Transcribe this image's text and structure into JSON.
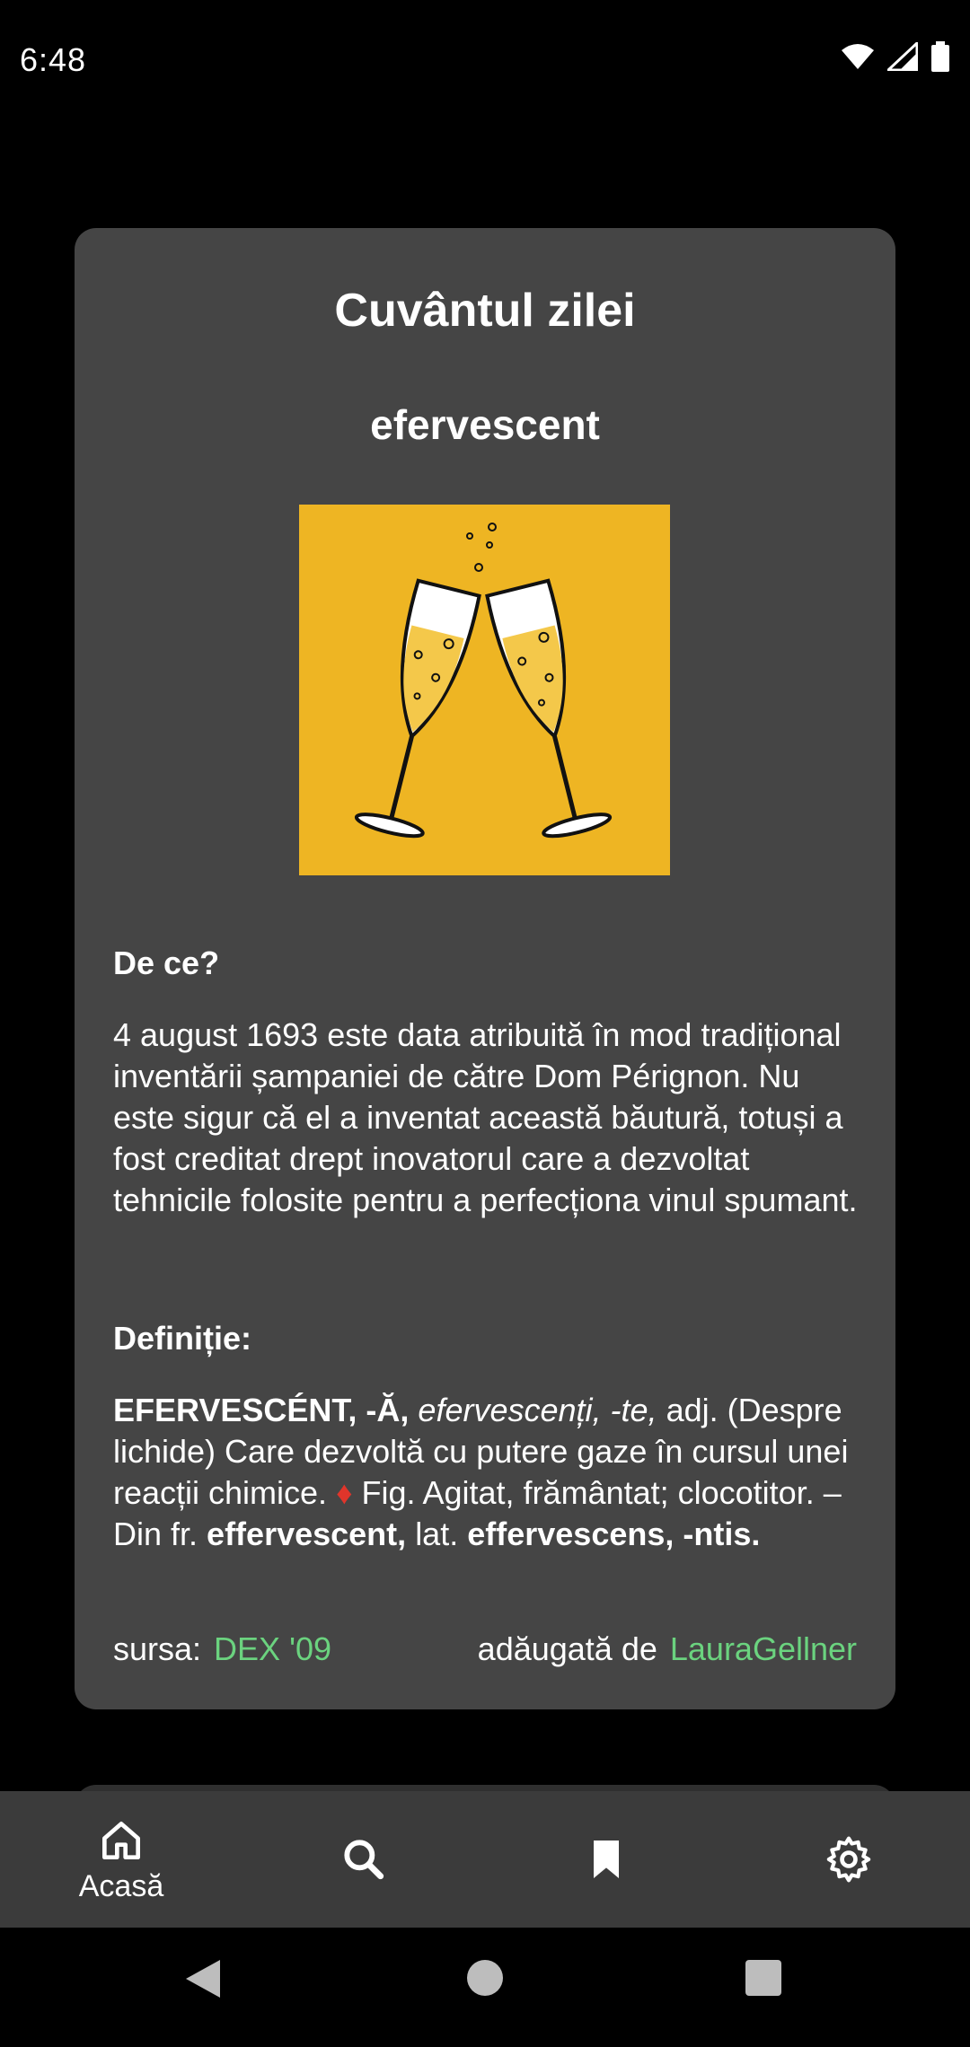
{
  "status_bar": {
    "time": "6:48"
  },
  "card": {
    "title": "Cuvântul zilei",
    "word": "efervescent",
    "why_label": "De ce?",
    "why_text": "4 august 1693 este data atribuită în mod tradițional inventării șampaniei de către Dom Pérignon. Nu este sigur că el a inventat această băutură, totuși a fost creditat drept inovatorul care a dezvoltat tehnicile folosite pentru a perfecționa vinul spumant.",
    "definition_label": "Definiție:",
    "definition": {
      "headword": "EFERVESCÉNT, -Ă,",
      "forms": "efervescenți, -te,",
      "pos": "adj.",
      "text1": "(Despre lichide) Care dezvoltă cu putere gaze în cursul unei reacții chimice.",
      "diamond": "♦",
      "text2": "Fig. Agitat, frământat; clocotitor. – Din fr.",
      "etym1": "effervescent,",
      "lat": "lat.",
      "etym2": "effervescens, -ntis."
    },
    "source_label": "sursa:",
    "source_value": "DEX '09",
    "added_label": "adăugată de",
    "added_value": "LauraGellner"
  },
  "bottom_nav": {
    "items": [
      {
        "label": "Acasă",
        "icon": "home-icon"
      },
      {
        "label": "",
        "icon": "search-icon"
      },
      {
        "label": "",
        "icon": "bookmark-icon"
      },
      {
        "label": "",
        "icon": "settings-icon"
      }
    ]
  },
  "colors": {
    "card_bg": "#454545",
    "link": "#6bd37f",
    "image_bg": "#eeb523",
    "nav_bg": "#3b3b3b"
  }
}
